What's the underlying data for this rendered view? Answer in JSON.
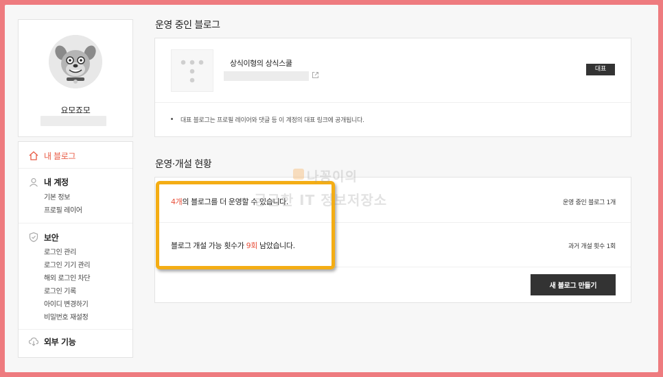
{
  "profile": {
    "name": "요모죠모"
  },
  "menu": {
    "my_blog": "내 블로그",
    "my_account": "내 계정",
    "account_items": [
      "기본 정보",
      "프로필 레이어"
    ],
    "security": "보안",
    "security_items": [
      "로그인 관리",
      "로그인 기기 관리",
      "해외 로그인 차단",
      "로그인 기록",
      "아이디 변경하기",
      "비밀번호 재설정"
    ],
    "external": "외부 기능"
  },
  "operating_blog": {
    "title": "운영 중인 블로그",
    "blog_name": "상식이형의 상식스쿨",
    "badge": "대표",
    "notice": "대표 블로그는 프로필 레이어와 댓글 등 이 계정의 대표 링크에 공개됩니다."
  },
  "status": {
    "title": "운영·개설 현황",
    "row1_highlight": "4개",
    "row1_rest": "의 블로그를 더 운영할 수 있습니다.",
    "row1_right": "운영 중인 블로그 1개",
    "row2_before": "블로그 개설 가능 횟수가 ",
    "row2_highlight": "9회",
    "row2_after": " 남았습니다.",
    "row2_right": "과거 개설 횟수 1회",
    "create_button": "새 블로그 만들기"
  },
  "watermark": {
    "line1": "나꽁이의",
    "line2": "궁금한 IT 정보저장소"
  },
  "colors": {
    "accent_red": "#e8513c",
    "highlight_border": "#f4ad14",
    "page_border": "#ee7b7f"
  }
}
